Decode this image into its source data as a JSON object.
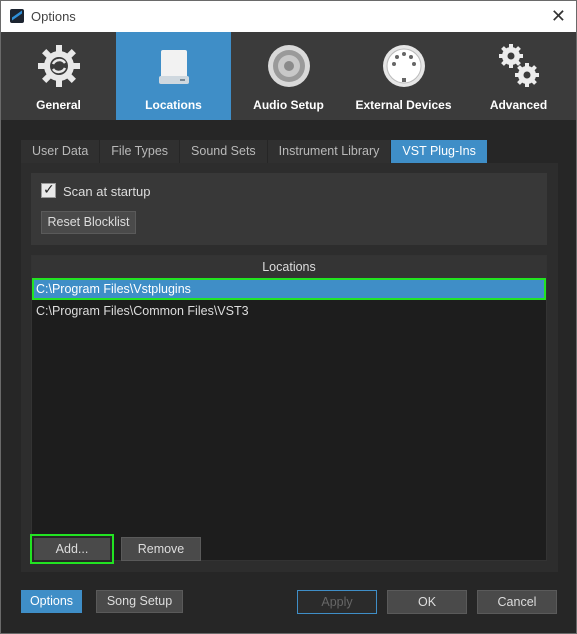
{
  "window": {
    "title": "Options"
  },
  "categories": [
    {
      "label": "General",
      "icon": "gear-icon"
    },
    {
      "label": "Locations",
      "icon": "drive-icon",
      "active": true
    },
    {
      "label": "Audio Setup",
      "icon": "speaker-icon"
    },
    {
      "label": "External Devices",
      "icon": "midi-connector-icon"
    },
    {
      "label": "Advanced",
      "icon": "gears-icon"
    }
  ],
  "subtabs": [
    {
      "label": "User Data"
    },
    {
      "label": "File Types"
    },
    {
      "label": "Sound Sets"
    },
    {
      "label": "Instrument Library"
    },
    {
      "label": "VST Plug-Ins",
      "active": true
    }
  ],
  "vst": {
    "scan_label": "Scan at startup",
    "scan_checked": true,
    "reset_label": "Reset Blocklist",
    "locations_header": "Locations",
    "locations": [
      "C:\\Program Files\\Vstplugins",
      "C:\\Program Files\\Common Files\\VST3"
    ],
    "add_label": "Add...",
    "remove_label": "Remove"
  },
  "footer": {
    "options_label": "Options",
    "song_setup_label": "Song Setup",
    "apply_label": "Apply",
    "ok_label": "OK",
    "cancel_label": "Cancel"
  },
  "colors": {
    "accent": "#3f8ec7",
    "highlight": "#22e322"
  }
}
